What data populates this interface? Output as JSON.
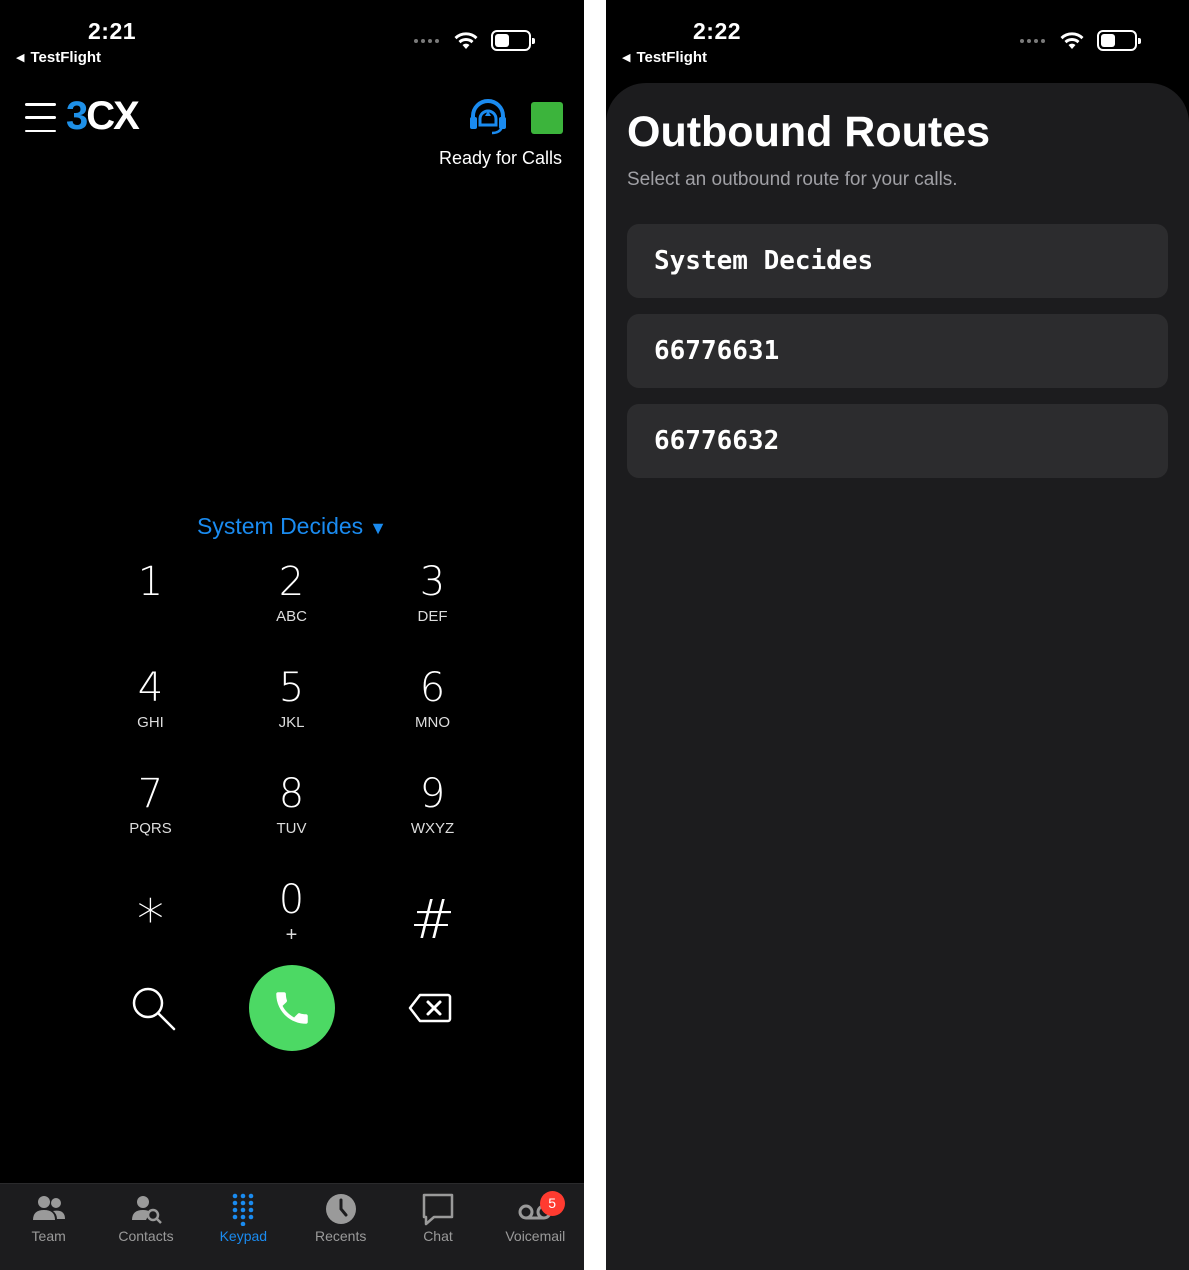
{
  "left_screen": {
    "status_bar": {
      "time": "2:21",
      "back_label": "TestFlight"
    },
    "header": {
      "logo_prefix": "3",
      "logo_suffix": "CX",
      "status_text": "Ready for Calls",
      "status_color": "#3cb43c"
    },
    "route_selector": {
      "label": "System Decides",
      "indicator": "▼"
    },
    "keypad": [
      {
        "digit": "1",
        "letters": ""
      },
      {
        "digit": "2",
        "letters": "ABC"
      },
      {
        "digit": "3",
        "letters": "DEF"
      },
      {
        "digit": "4",
        "letters": "GHI"
      },
      {
        "digit": "5",
        "letters": "JKL"
      },
      {
        "digit": "6",
        "letters": "MNO"
      },
      {
        "digit": "7",
        "letters": "PQRS"
      },
      {
        "digit": "8",
        "letters": "TUV"
      },
      {
        "digit": "9",
        "letters": "WXYZ"
      },
      {
        "digit": "*",
        "letters": ""
      },
      {
        "digit": "0",
        "letters": "+"
      },
      {
        "digit": "#",
        "letters": ""
      }
    ],
    "tabbar": {
      "items": [
        {
          "label": "Team",
          "icon": "team-icon"
        },
        {
          "label": "Contacts",
          "icon": "contacts-icon"
        },
        {
          "label": "Keypad",
          "icon": "keypad-icon",
          "active": true
        },
        {
          "label": "Recents",
          "icon": "clock-icon"
        },
        {
          "label": "Chat",
          "icon": "chat-icon"
        },
        {
          "label": "Voicemail",
          "icon": "voicemail-icon",
          "badge": "5"
        }
      ]
    },
    "accent_color": "#1a8bf0",
    "call_color": "#4cd964"
  },
  "right_screen": {
    "status_bar": {
      "time": "2:22",
      "back_label": "TestFlight"
    },
    "title": "Outbound Routes",
    "subtitle": "Select an outbound route for your calls.",
    "routes": [
      {
        "label": "System Decides"
      },
      {
        "label": "66776631"
      },
      {
        "label": "66776632"
      }
    ]
  }
}
